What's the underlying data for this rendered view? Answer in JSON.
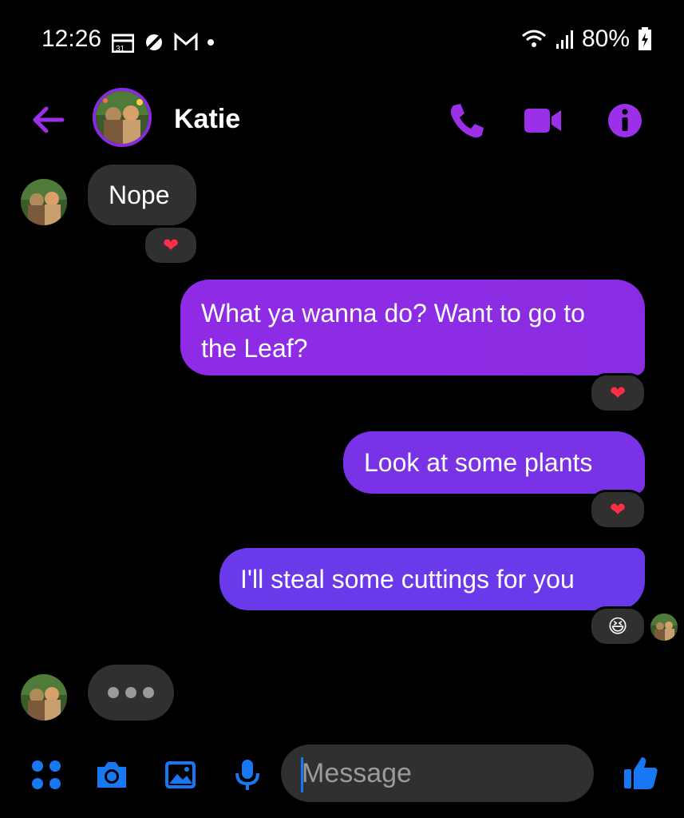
{
  "status_bar": {
    "time": "12:26",
    "battery": "80%",
    "left_icons": [
      "calendar-icon",
      "no-tracking-icon",
      "gmail-icon",
      "dot-icon"
    ],
    "right_icons": [
      "wifi-icon",
      "signal-icon",
      "battery-charging-icon"
    ]
  },
  "header": {
    "title": "Katie",
    "icons": [
      "back-arrow-icon",
      "phone-icon",
      "video-icon",
      "info-icon"
    ],
    "accent_color": "#9b30e8"
  },
  "messages": [
    {
      "sender": "Katie",
      "direction": "incoming",
      "text": "Nope",
      "reaction": "❤️"
    },
    {
      "sender": "me",
      "direction": "outgoing",
      "text": "What ya wanna do? Want to go to the Leaf?",
      "reaction": "❤️"
    },
    {
      "sender": "me",
      "direction": "outgoing",
      "text": "Look at some plants",
      "reaction": "❤️"
    },
    {
      "sender": "me",
      "direction": "outgoing",
      "text": "I'll steal some cuttings for you",
      "reaction": "😆"
    }
  ],
  "typing_indicator": "•••",
  "composer": {
    "placeholder": "Message",
    "icons": [
      "apps-icon",
      "camera-icon",
      "image-icon",
      "microphone-icon",
      "thumbs-up-icon"
    ],
    "accent_color": "#1877f2"
  }
}
